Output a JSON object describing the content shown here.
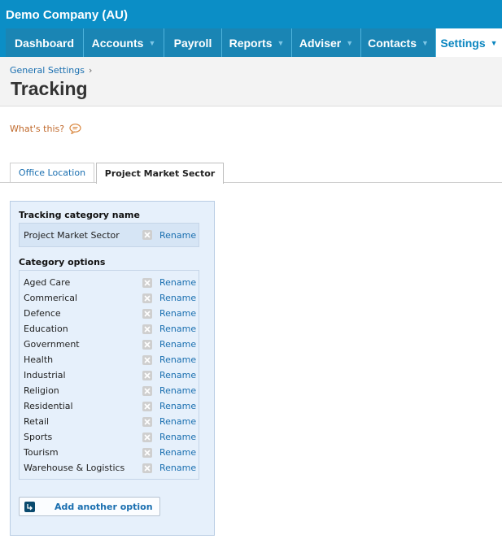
{
  "company": "Demo Company (AU)",
  "nav": [
    {
      "label": "Dashboard",
      "caret": false
    },
    {
      "label": "Accounts",
      "caret": true
    },
    {
      "label": "Payroll",
      "caret": false
    },
    {
      "label": "Reports",
      "caret": true
    },
    {
      "label": "Adviser",
      "caret": true
    },
    {
      "label": "Contacts",
      "caret": true
    },
    {
      "label": "Settings",
      "caret": true,
      "active": true
    }
  ],
  "breadcrumb": {
    "label": "General Settings",
    "separator": "›"
  },
  "page_title": "Tracking",
  "whats_this": "What's this?",
  "tabs": [
    {
      "label": "Office Location",
      "active": false
    },
    {
      "label": "Project Market Sector",
      "active": true
    }
  ],
  "panel": {
    "category_name_label": "Tracking category name",
    "category_name": "Project Market Sector",
    "options_label": "Category options",
    "rename_label": "Rename",
    "options": [
      "Aged Care",
      "Commerical",
      "Defence",
      "Education",
      "Government",
      "Health",
      "Industrial",
      "Religion",
      "Residential",
      "Retail",
      "Sports",
      "Tourism",
      "Warehouse & Logistics"
    ],
    "add_button": "Add another option"
  },
  "colors": {
    "header": "#0b8ec6",
    "nav_item": "#1a85b4",
    "link": "#1a6fb0",
    "panel_bg": "#e6f0fb",
    "whats_this": "#c0692b"
  },
  "icons": {
    "delete": "close-icon",
    "add": "add-row-icon",
    "help": "speech-bubble-icon",
    "dropdown": "caret-down-icon"
  }
}
